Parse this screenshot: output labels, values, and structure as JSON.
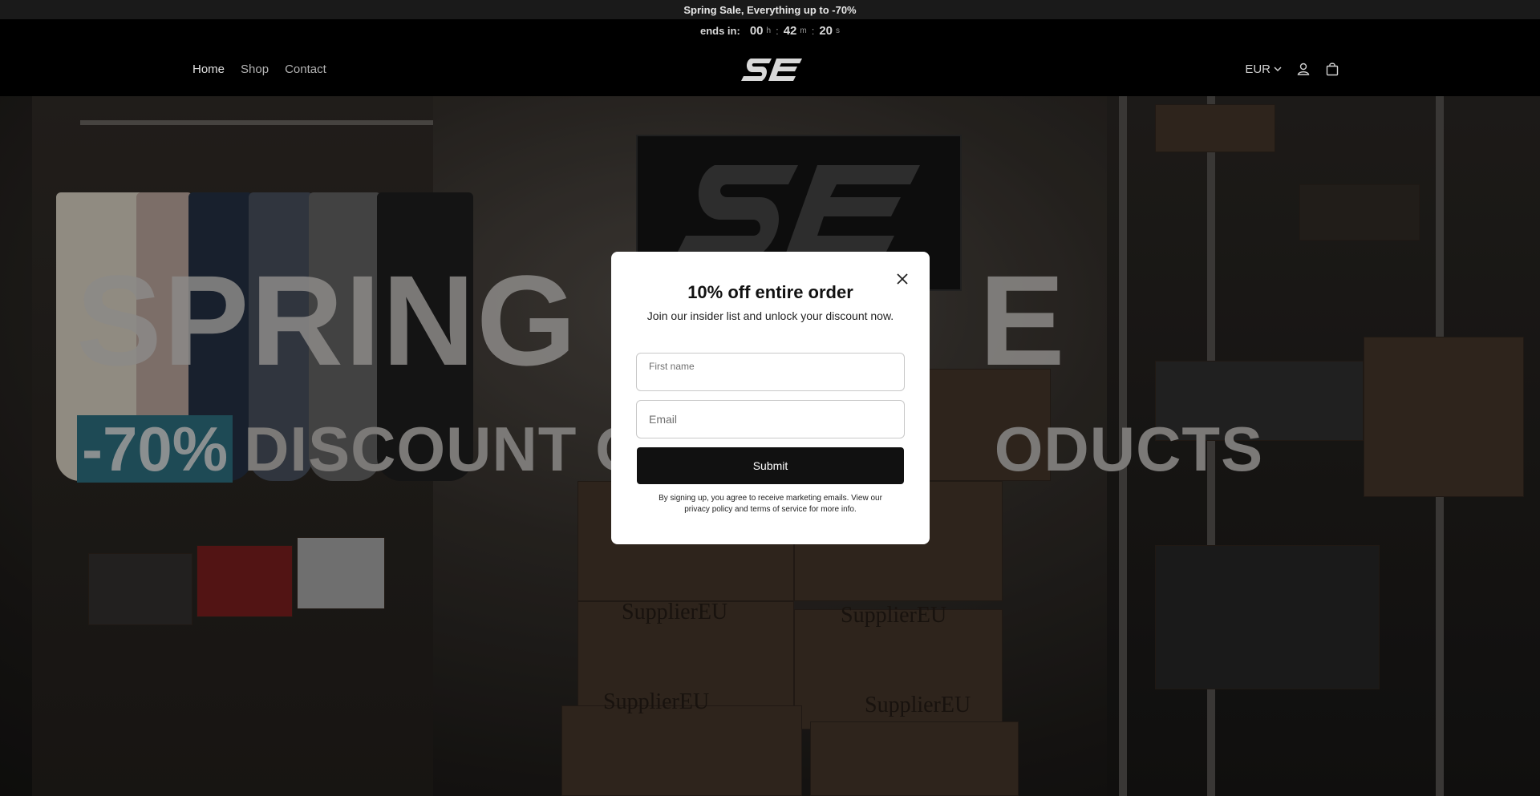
{
  "announcement": {
    "text": "Spring Sale, Everything up to -70%"
  },
  "countdown": {
    "label": "ends in:",
    "hours": "00",
    "hours_unit": "h",
    "minutes": "42",
    "minutes_unit": "m",
    "seconds": "20",
    "seconds_unit": "s",
    "separator": ":"
  },
  "nav": {
    "items": [
      {
        "label": "Home"
      },
      {
        "label": "Shop"
      },
      {
        "label": "Contact"
      }
    ]
  },
  "header": {
    "currency": "EUR",
    "icons": [
      "chevron-down-icon",
      "account-icon",
      "cart-icon"
    ]
  },
  "hero": {
    "title": "SPRING",
    "title_tail": "E",
    "discount": "-70%",
    "subtitle_left": "DISCOUNT O",
    "subtitle_right": "ODUCTS",
    "box_label": "SupplierEU"
  },
  "modal": {
    "title": "10% off entire order",
    "text": "Join our insider list and unlock your discount now.",
    "first_name_placeholder": "First name",
    "email_placeholder": "Email",
    "submit_label": "Submit",
    "legal": "By signing up, you agree to receive marketing emails. View our privacy policy and terms of service for more info."
  },
  "colors": {
    "announce_bg": "#1a1a1a",
    "header_bg": "#000000",
    "badge_bg": "#1e4a55",
    "submit_bg": "#111111"
  }
}
